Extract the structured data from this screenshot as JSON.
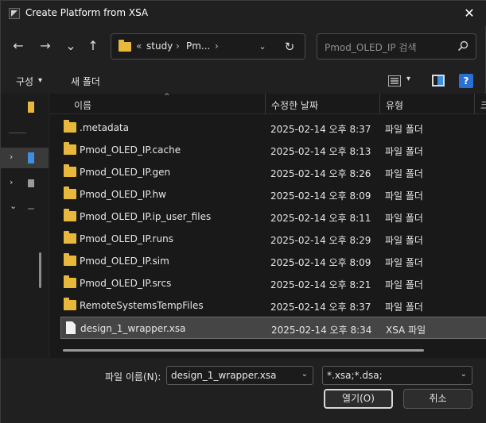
{
  "window": {
    "title": "Create Platform from XSA",
    "close_glyph": "✕"
  },
  "nav": {
    "back_glyph": "←",
    "forward_glyph": "→",
    "recent_glyph": "⌄",
    "up_glyph": "↑",
    "breadcrumb": {
      "overflow": "«",
      "items": [
        "study",
        "Pm..."
      ],
      "sep": "›",
      "trailing_sep": "›"
    },
    "dropdown_glyph": "⌄",
    "refresh_glyph": "↻",
    "search_placeholder": "Pmod_OLED_IP 검색"
  },
  "command_bar": {
    "organize": "구성",
    "organize_caret": "▾",
    "new_folder": "새 폴더",
    "view_caret": "▾",
    "help": "?"
  },
  "navpane": {
    "expanders": [
      "›",
      "›",
      "⌄"
    ]
  },
  "columns": {
    "name": "이름",
    "date": "수정한 날짜",
    "type": "유형",
    "size": "크",
    "sort_glyph": "^"
  },
  "files": [
    {
      "name": ".metadata",
      "date": "2025-02-14 오후 8:37",
      "type": "파일 폴더",
      "kind": "folder"
    },
    {
      "name": "Pmod_OLED_IP.cache",
      "date": "2025-02-14 오후 8:13",
      "type": "파일 폴더",
      "kind": "folder"
    },
    {
      "name": "Pmod_OLED_IP.gen",
      "date": "2025-02-14 오후 8:26",
      "type": "파일 폴더",
      "kind": "folder"
    },
    {
      "name": "Pmod_OLED_IP.hw",
      "date": "2025-02-14 오후 8:09",
      "type": "파일 폴더",
      "kind": "folder"
    },
    {
      "name": "Pmod_OLED_IP.ip_user_files",
      "date": "2025-02-14 오후 8:11",
      "type": "파일 폴더",
      "kind": "folder"
    },
    {
      "name": "Pmod_OLED_IP.runs",
      "date": "2025-02-14 오후 8:29",
      "type": "파일 폴더",
      "kind": "folder"
    },
    {
      "name": "Pmod_OLED_IP.sim",
      "date": "2025-02-14 오후 8:09",
      "type": "파일 폴더",
      "kind": "folder"
    },
    {
      "name": "Pmod_OLED_IP.srcs",
      "date": "2025-02-14 오후 8:21",
      "type": "파일 폴더",
      "kind": "folder"
    },
    {
      "name": "RemoteSystemsTempFiles",
      "date": "2025-02-14 오후 8:37",
      "type": "파일 폴더",
      "kind": "folder"
    },
    {
      "name": "design_1_wrapper.xsa",
      "date": "2025-02-14 오후 8:34",
      "type": "XSA 파일",
      "kind": "file",
      "selected": true
    }
  ],
  "footer": {
    "filename_label": "파일 이름(N):",
    "filename_value": "design_1_wrapper.xsa",
    "filter_value": "*.xsa;*.dsa;",
    "caret": "⌄",
    "open_button": "열기(O)",
    "cancel_button": "취소"
  },
  "colors": {
    "folder": "#e8b83d",
    "accent": "#3d8fe0",
    "help": "#2a6fd1"
  }
}
